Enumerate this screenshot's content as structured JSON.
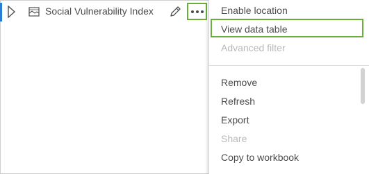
{
  "layer": {
    "name": "Social Vulnerability Index",
    "expand_icon": "chevron-right-icon",
    "type_icon": "map-layer-icon",
    "edit_icon": "pencil-icon",
    "more_icon": "ellipsis-icon"
  },
  "menu": {
    "group1": [
      {
        "label": "Enable location",
        "enabled": true
      },
      {
        "label": "View data table",
        "enabled": true,
        "highlighted": true
      },
      {
        "label": "Advanced filter",
        "enabled": false
      }
    ],
    "group2": [
      {
        "label": "Remove",
        "enabled": true
      },
      {
        "label": "Refresh",
        "enabled": true
      },
      {
        "label": "Export",
        "enabled": true
      },
      {
        "label": "Share",
        "enabled": false
      },
      {
        "label": "Copy to workbook",
        "enabled": true
      }
    ]
  },
  "colors": {
    "accent_highlight": "#6bae3c",
    "active_indicator": "#2a7fd4",
    "text": "#4c4c4c",
    "disabled_text": "#b8b8b8"
  }
}
